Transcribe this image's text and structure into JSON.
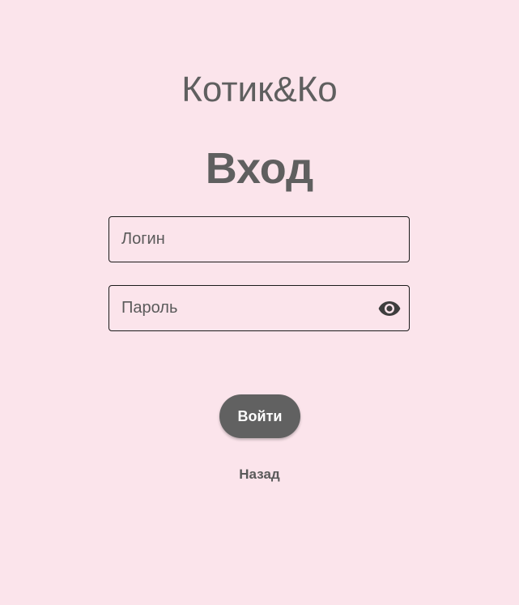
{
  "app": {
    "title": "Котик&Ко"
  },
  "login_form": {
    "heading": "Вход",
    "login_field": {
      "placeholder": "Логин",
      "value": ""
    },
    "password_field": {
      "placeholder": "Пароль",
      "value": "",
      "toggle_icon": "eye-icon"
    },
    "submit_label": "Войти",
    "back_label": "Назад"
  },
  "colors": {
    "background": "#fbe4eb",
    "text": "#5f5f5f",
    "button": "#616161",
    "button_text": "#ffffff",
    "field_border": "#1b1b1b"
  }
}
